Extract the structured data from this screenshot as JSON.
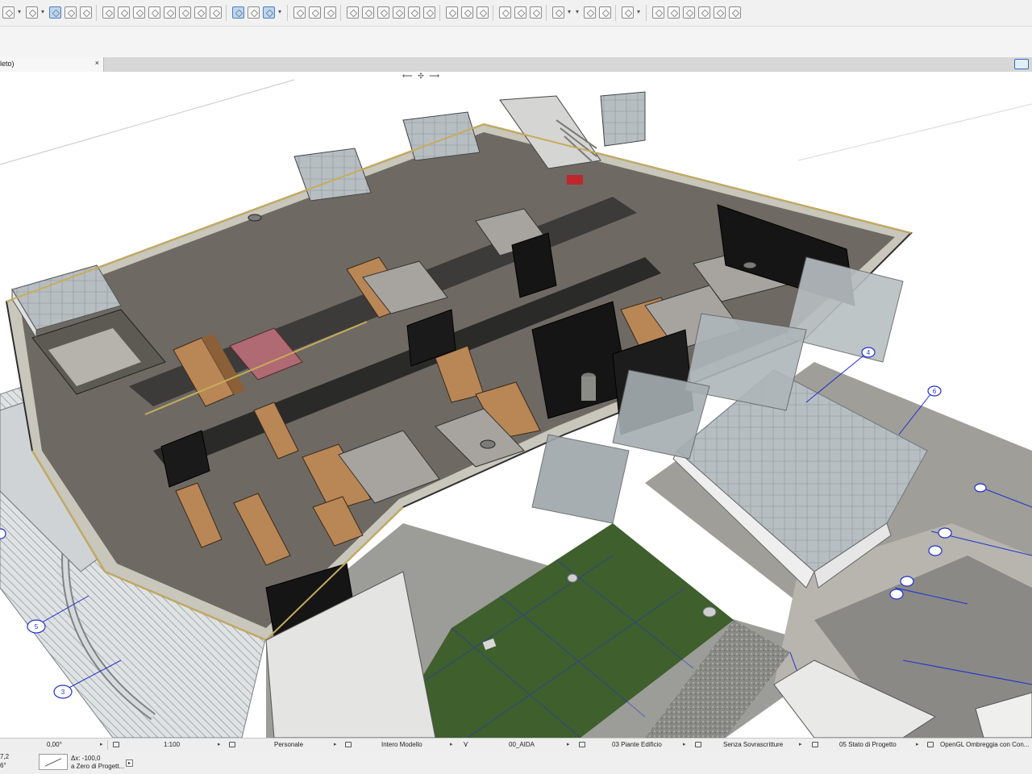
{
  "colors": {
    "selection_accent": "#4a7fc0",
    "grid_line": "#2030d0",
    "lawn": "#3f5f2d",
    "wood": "#b98656",
    "floor": "#6e6a63",
    "black_wall": "#151515",
    "glass": "#a9b3b8",
    "roof_pink": "#b06a73"
  },
  "toolbar": {
    "icons": [
      "select-icon",
      "dropdown-arrow",
      "lock-icon",
      "dropdown-arrow",
      "marquee-icon",
      "table-icon",
      "xmark-icon",
      "split-icon",
      "magic-wand-icon",
      "trim-icon",
      "trim-icon",
      "intersect-icon",
      "resize-icon",
      "rotate-icon",
      "adjust-icon",
      "edit-pen-icon",
      "rotate-view-icon",
      "3d-view-icon",
      "dropdown-arrow",
      "chart-icon",
      "zoom-icon",
      "elevation-icon",
      "scissors-icon",
      "section-icon",
      "zoom-icon",
      "corner-icon",
      "corner-icon",
      "layout-icon",
      "box-icon",
      "circle-icon",
      "undo-icon",
      "columns-icon",
      "grid-icon",
      "beams-icon",
      "view-icon",
      "dropdown-arrow",
      "dropdown-arrow",
      "toggle-icon",
      "tag-icon",
      "brush-icon",
      "dropdown-arrow",
      "home-icon",
      "edit-icon",
      "save-icon",
      "xmark-icon",
      "redo-icon",
      "refresh-icon"
    ]
  },
  "tab": {
    "label": "leto)",
    "close": "×"
  },
  "viewport": {
    "nav_widget": "⟵ ✣ ⟶",
    "grid_markers": [
      "4",
      "6",
      "5",
      "3",
      "8"
    ]
  },
  "statusbar": {
    "angle": "0,00°",
    "scale": "1:100",
    "layer_combo": "Personale",
    "model_view": "Intero Modello",
    "pen_set": "00_AIDA",
    "view_map": "03 Piante Edificio",
    "overrides": "Senza Sovrascritture",
    "renovation": "05 Stato di Progetto",
    "render_mode": "OpenGL Ombreggia con Con..."
  },
  "coordbar": {
    "coord_x": "7,2",
    "coord_y": "6°",
    "dx": "Δx: -100,0",
    "origin": "a Zero di Progett..."
  }
}
